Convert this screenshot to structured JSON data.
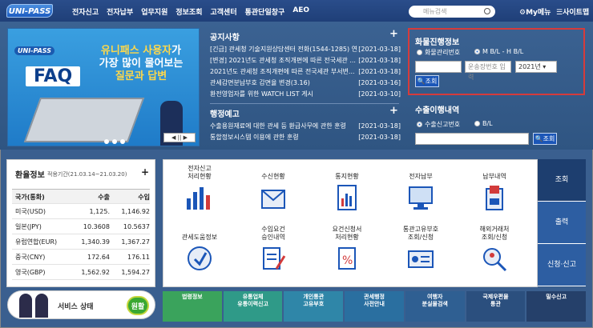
{
  "header": {
    "logo": "UNI-PASS",
    "nav": [
      "전자신고",
      "전자납부",
      "업무지원",
      "정보조회",
      "고객센터",
      "통관단일창구",
      "AEO"
    ],
    "search_placeholder": "메뉴검색",
    "mymenu": "My메뉴",
    "sitemap": "사이트맵"
  },
  "faq_banner": {
    "logo": "UNI-PASS",
    "big": "FAQ",
    "line1a": "유니패스 사용자",
    "line1b": "가",
    "line2": "가장 많이 물어보는",
    "line3": "질문과 답변",
    "control": "◀ || ▶"
  },
  "notice": {
    "title": "공지사항",
    "plus": "+",
    "items": [
      {
        "text": "[긴급] 관세청 기술지원상담센터 전화(1544-1285) 연...",
        "date": "[2021-03-18]"
      },
      {
        "text": "[변경] 2021년도 관세청 조직개편에 따른 전국세관 ...",
        "date": "[2021-03-18]"
      },
      {
        "text": "2021년도 관세청 조직개편에 따른 전국세관 부서변...",
        "date": "[2021-03-18]"
      },
      {
        "text": "관세감면분납부호 감면율 변경(3.16)",
        "date": "[2021-03-16]"
      },
      {
        "text": "환전영업자를 위한 WATCH LIST 게시",
        "date": "[2021-03-10]"
      }
    ]
  },
  "admin_notice": {
    "title": "행정예고",
    "plus": "+",
    "items": [
      {
        "text": "수출용원재료에 대한 관세 등 환급사무에 관한 훈령",
        "date": "[2021-03-18]"
      },
      {
        "text": "통합정보시스템 이용에 관한 훈령",
        "date": "[2021-03-18]"
      }
    ]
  },
  "cargo": {
    "title": "화물진행정보",
    "radio1": "화물관리번호",
    "radio2": "M B/L - H B/L",
    "input_placeholder": "운송장번호 입력",
    "year": "2021년 ▾",
    "button": "🔍조회"
  },
  "export": {
    "title": "수출이행내역",
    "radio1": "수출신고번호",
    "radio2": "B/L",
    "button": "🔍조회"
  },
  "exchange": {
    "title": "환율정보",
    "period": "적용기간(21.03.14~21.03.20)",
    "plus": "+",
    "headers": [
      "국가(통화)",
      "수출",
      "수입"
    ],
    "rows": [
      [
        "미국(USD)",
        "1,125.",
        "1,146.92"
      ],
      [
        "일본(JPY)",
        "10.3608",
        "10.5637"
      ],
      [
        "유럽연합(EUR)",
        "1,340.39",
        "1,367.27"
      ],
      [
        "중국(CNY)",
        "172.64",
        "176.11"
      ],
      [
        "영국(GBP)",
        "1,562.92",
        "1,594.27"
      ]
    ]
  },
  "service": {
    "label": "서비스 상태",
    "status": "원활"
  },
  "quick": [
    "전자신고\n처리현황",
    "수신현황",
    "통지현황",
    "전자납부",
    "납부내역",
    "관세도움정보",
    "수입요건\n승인내역",
    "요건신청서\n처리현황",
    "통관고유부호\n조회/신청",
    "해외거래처\n조회/신청"
  ],
  "tabs": [
    "조회",
    "출력",
    "신청·신고"
  ],
  "banners": [
    {
      "text": "법령정보",
      "color": "#3aa35c"
    },
    {
      "text": "유통업체\n유통이력신고",
      "color": "#2f9a88"
    },
    {
      "text": "개인통관\n고유부호",
      "color": "#2f86a8"
    },
    {
      "text": "관세행정\n사전안내",
      "color": "#2a6fa0"
    },
    {
      "text": "여행자\n분실물검색",
      "color": "#2f5f92"
    },
    {
      "text": "국제우편물\n통관",
      "color": "#2b4f7e"
    },
    {
      "text": "밀수신고",
      "color": "#25406a"
    }
  ],
  "colors": {
    "accent": "#1b56b8",
    "header": "#1f3f78",
    "band": "#3a5f8f",
    "highlight": "#d63b3b"
  }
}
